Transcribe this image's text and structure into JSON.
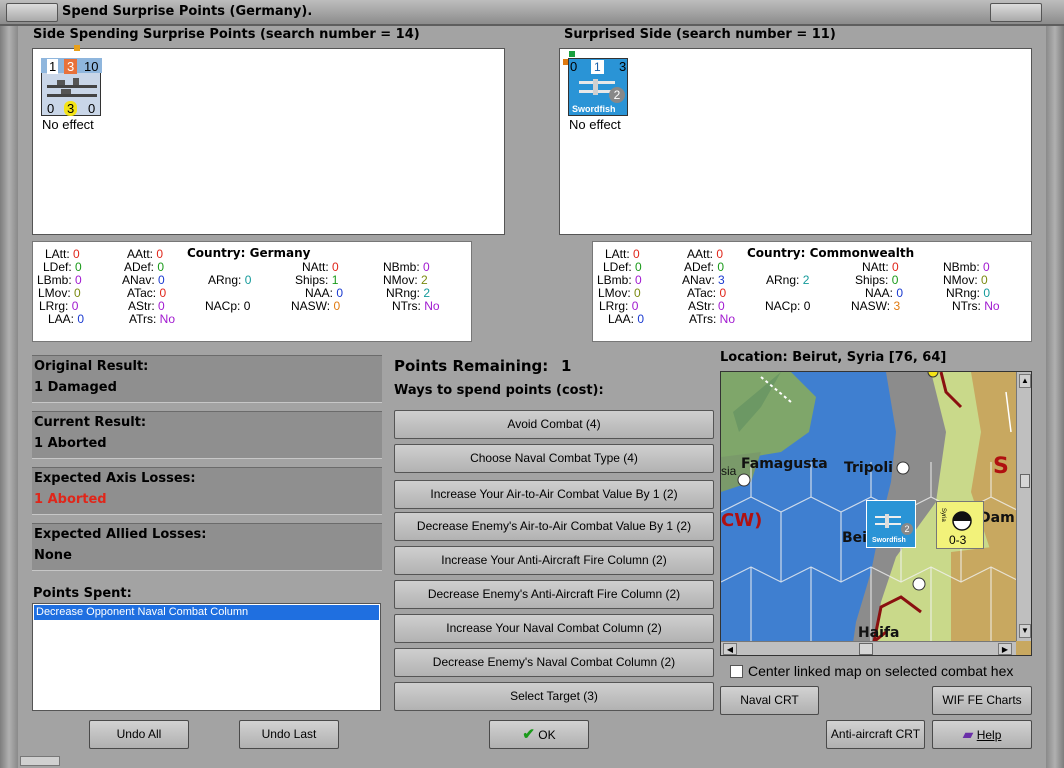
{
  "window": {
    "title": "Spend Surprise Points (Germany)."
  },
  "left_side": {
    "header": "Side Spending Surprise Points (search number = 14)",
    "unit": {
      "top_left": "1",
      "top_mid": "3",
      "top_right": "10",
      "bottom_left": "0",
      "bottom_mid": "3",
      "bottom_right": "0"
    },
    "effect": "No effect",
    "stats": {
      "country": "Country: Germany",
      "LAtt": "0",
      "LDef": "0",
      "LBmb": "0",
      "LMov": "0",
      "LRrg": "0",
      "LAA": "0",
      "AAtt": "0",
      "ADef": "0",
      "ANav": "0",
      "ATac": "0",
      "AStr": "0",
      "ATrs": "No",
      "ARng": "0",
      "NACp": "0",
      "NAtt": "0",
      "Ships": "1",
      "NAA": "0",
      "NASW": "0",
      "NBmb": "0",
      "NMov": "2",
      "NRng": "2",
      "NTrs": "No"
    }
  },
  "right_side": {
    "header": "Surprised Side (search number = 11)",
    "unit": {
      "left": "0",
      "mid": "1",
      "right": "3",
      "badge": "2",
      "name": "Swordfish"
    },
    "effect": "No effect",
    "stats": {
      "country": "Country: Commonwealth",
      "LAtt": "0",
      "LDef": "0",
      "LBmb": "0",
      "LMov": "0",
      "LRrg": "0",
      "LAA": "0",
      "AAtt": "0",
      "ADef": "0",
      "ANav": "3",
      "ATac": "0",
      "AStr": "0",
      "ATrs": "No",
      "ARng": "2",
      "NACp": "0",
      "NAtt": "0",
      "Ships": "0",
      "NAA": "0",
      "NASW": "3",
      "NBmb": "0",
      "NMov": "0",
      "NRng": "0",
      "NTrs": "No"
    }
  },
  "stat_labels": {
    "LAtt": "LAtt:",
    "LDef": "LDef:",
    "LBmb": "LBmb:",
    "LMov": "LMov:",
    "LRrg": "LRrg:",
    "LAA": "LAA:",
    "AAtt": "AAtt:",
    "ADef": "ADef:",
    "ANav": "ANav:",
    "ATac": "ATac:",
    "AStr": "AStr:",
    "ATrs": "ATrs:",
    "ARng": "ARng:",
    "NACp": "NACp:",
    "NAtt": "NAtt:",
    "Ships": "Ships:",
    "NAA": "NAA:",
    "NASW": "NASW:",
    "NBmb": "NBmb:",
    "NMov": "NMov:",
    "NRng": "NRng:",
    "NTrs": "NTrs:"
  },
  "results": {
    "original_label": "Original Result:",
    "original_value": "1 Damaged",
    "current_label": "Current Result:",
    "current_value": "1 Aborted",
    "axis_label": "Expected Axis Losses:",
    "axis_value": "1 Aborted",
    "allied_label": "Expected Allied Losses:",
    "allied_value": "None"
  },
  "points_spent": {
    "label": "Points Spent:",
    "items": [
      "Decrease Opponent Naval Combat Column"
    ]
  },
  "spend": {
    "remaining_label": "Points Remaining:",
    "remaining_value": "1",
    "ways_label": "Ways to spend points (cost):",
    "buttons": [
      "Avoid Combat (4)",
      "Choose Naval Combat Type (4)",
      "Increase Your Air-to-Air Combat Value By 1 (2)",
      "Decrease Enemy's Air-to-Air Combat Value By 1 (2)",
      "Increase Your Anti-Aircraft Fire Column (2)",
      "Decrease Enemy's Anti-Aircraft Fire Column (2)",
      "Increase Your Naval Combat Column (2)",
      "Decrease Enemy's Naval Combat Column (2)",
      "Select Target (3)"
    ]
  },
  "map": {
    "location": "Location: Beirut, Syria [76, 64]",
    "labels": {
      "famagusta": "Famagusta",
      "tripoli": "Tripoli",
      "beirut": "Beir",
      "haifa": "Haifa",
      "sia": "sia",
      "cw": "CW)",
      "dam": "Dam",
      "sy": "S"
    },
    "counter_value": "0-3",
    "counter_side": "Syria",
    "swordfish": "Swordfish",
    "stack_count": "2",
    "center_option": "Center linked map on selected combat hex"
  },
  "buttons": {
    "undo_all": "Undo All",
    "undo_last": "Undo Last",
    "ok": "OK",
    "naval_crt": "Naval CRT",
    "wif_charts": "WIF FE Charts",
    "aa_crt": "Anti-aircraft CRT",
    "help": "Help"
  },
  "colors": {
    "sea": "#3f7fd0",
    "land": "#c8a860",
    "hex_green": "#c9d98a",
    "result_red": "#e0261a",
    "selection_blue": "#1f6fe0"
  }
}
